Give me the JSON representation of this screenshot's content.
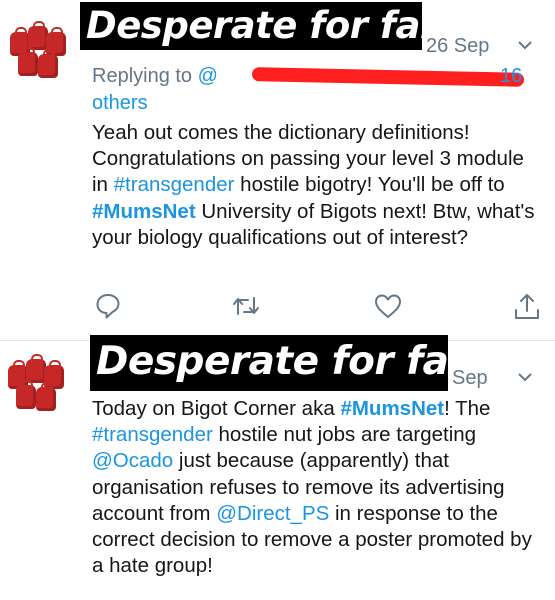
{
  "tweets": [
    {
      "overlay_label": "Desperate for fame",
      "date": "26 Sep",
      "replying_prefix": "Replying to",
      "replying_handle": "@",
      "replying_count": "16",
      "replying_others": "others",
      "body": [
        {
          "t": "text",
          "v": "Yeah out comes the dictionary definitions! Congratulations on passing your level 3 module in "
        },
        {
          "t": "link",
          "v": "#transgender"
        },
        {
          "t": "text",
          "v": " hostile bigotry! You'll be off to "
        },
        {
          "t": "bold",
          "v": "#MumsNet"
        },
        {
          "t": "text",
          "v": " University of Bigots next! Btw, what's your biology qualifications out of interest?"
        }
      ]
    },
    {
      "overlay_label": "Desperate for fame",
      "date": "Sep",
      "body": [
        {
          "t": "text",
          "v": "Today on Bigot Corner aka "
        },
        {
          "t": "bold",
          "v": "#MumsNet"
        },
        {
          "t": "text",
          "v": "! The "
        },
        {
          "t": "link",
          "v": "#transgender"
        },
        {
          "t": "text",
          "v": " hostile nut jobs are targeting "
        },
        {
          "t": "link",
          "v": "@Ocado"
        },
        {
          "t": "text",
          "v": " just because (apparently) that organisation refuses to remove its advertising account from "
        },
        {
          "t": "link",
          "v": "@Direct_PS"
        },
        {
          "t": "text",
          "v": " in response to the correct decision to remove a poster promoted by a hate group!"
        }
      ]
    }
  ],
  "icons": {
    "reply": "reply-icon",
    "retweet": "retweet-icon",
    "like": "heart-icon",
    "share": "share-icon",
    "more": "chevron-down-icon"
  },
  "colors": {
    "link": "#1b95e0",
    "muted": "#657786",
    "redaction": "#ff1f1f",
    "avatar": "#c62828"
  }
}
